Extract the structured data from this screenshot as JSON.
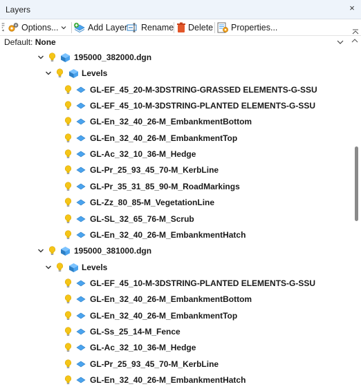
{
  "window": {
    "title": "Layers",
    "close_glyph": "×"
  },
  "toolbar": {
    "options_label": "Options...",
    "add_layer_label": "Add Layer",
    "rename_label": "Rename",
    "delete_label": "Delete",
    "properties_label": "Properties..."
  },
  "default_layer": {
    "label": "Default:",
    "value": "None"
  },
  "tree": {
    "files": [
      {
        "name": "195000_382000.dgn",
        "group_label": "Levels",
        "levels": [
          "GL-EF_45_20-M-3DSTRING-GRASSED ELEMENTS-G-SSU",
          "GL-EF_45_10-M-3DSTRING-PLANTED ELEMENTS-G-SSU",
          "GL-En_32_40_26-M_EmbankmentBottom",
          "GL-En_32_40_26-M_EmbankmentTop",
          "GL-Ac_32_10_36-M_Hedge",
          "GL-Pr_25_93_45_70-M_KerbLine",
          "GL-Pr_35_31_85_90-M_RoadMarkings",
          "GL-Zz_80_85-M_VegetationLine",
          "GL-SL_32_65_76-M_Scrub",
          "GL-En_32_40_26-M_EmbankmentHatch"
        ]
      },
      {
        "name": "195000_381000.dgn",
        "group_label": "Levels",
        "levels": [
          "GL-EF_45_10-M-3DSTRING-PLANTED ELEMENTS-G-SSU",
          "GL-En_32_40_26-M_EmbankmentBottom",
          "GL-En_32_40_26-M_EmbankmentTop",
          "GL-Ss_25_14-M_Fence",
          "GL-Ac_32_10_36-M_Hedge",
          "GL-Pr_25_93_45_70-M_KerbLine",
          "GL-En_32_40_26-M_EmbankmentHatch"
        ]
      }
    ]
  },
  "icons": {
    "bulb": "lightbulb-icon",
    "file": "reference-file-icon",
    "level": "level-icon",
    "colors": {
      "bulb": "#f5c518",
      "level_blue": "#4aa3ee",
      "delete_red": "#e2572a"
    }
  }
}
